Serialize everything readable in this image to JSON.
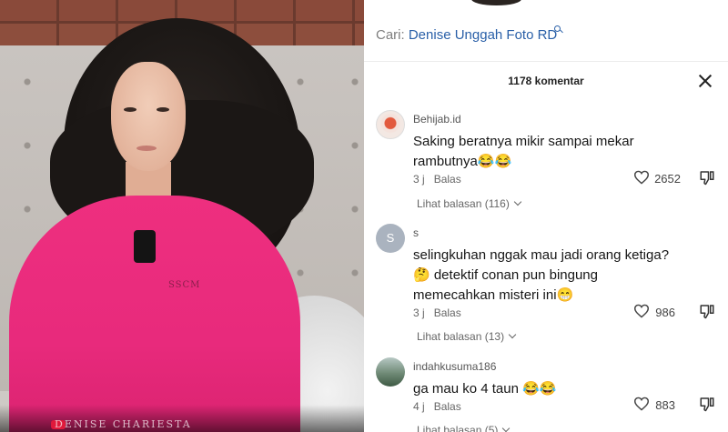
{
  "video": {
    "watermark": "DENISE CHARIESTA",
    "shirt_print": "SSCM"
  },
  "search": {
    "prefix": "Cari: ",
    "query": "Denise Unggah Foto RD",
    "icon": "search-icon"
  },
  "comments_header": {
    "count_label": "1178 komentar",
    "close_icon": "close-icon"
  },
  "comments": [
    {
      "username": "Behijab.id",
      "text": "Saking beratnya mikir sampai mekar rambutnya😂😂",
      "time": "3 j",
      "reply_label": "Balas",
      "likes": "2652",
      "replies_label": "Lihat balasan (116)"
    },
    {
      "username": "s",
      "avatar_letter": "S",
      "text": "selingkuhan nggak mau jadi orang ketiga? 🤔 detektif conan pun bingung memecahkan misteri ini😁",
      "time": "3 j",
      "reply_label": "Balas",
      "likes": "986",
      "replies_label": "Lihat balasan (13)"
    },
    {
      "username": "indahkusuma186",
      "text": "ga mau ko 4 taun 😂😂",
      "time": "4 j",
      "reply_label": "Balas",
      "likes": "883",
      "replies_label": "Lihat balasan (5)"
    }
  ],
  "colors": {
    "accent": "#2a60a8",
    "shirt": "#e82a7c",
    "text": "#161616",
    "muted": "#666666"
  }
}
